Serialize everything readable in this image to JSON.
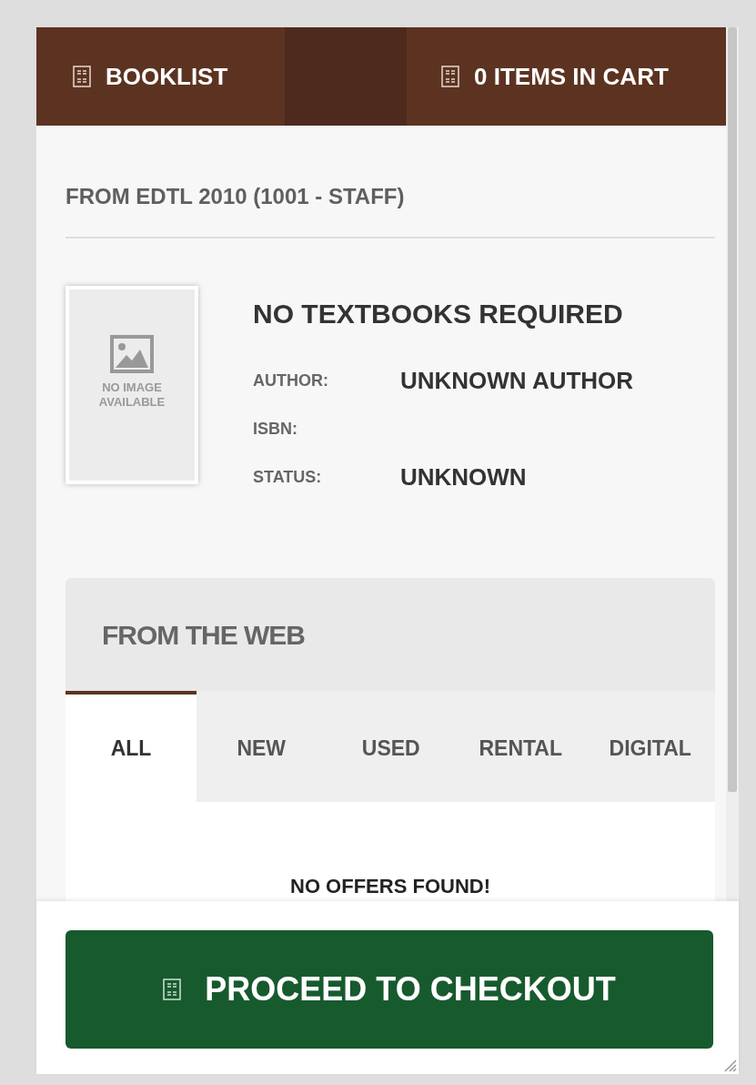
{
  "nav": {
    "booklist": "BOOKLIST",
    "cart": "0 ITEMS IN CART"
  },
  "course": "FROM EDTL 2010 (1001 - STAFF)",
  "book": {
    "cover_text": "NO IMAGE AVAILABLE",
    "title": "NO TEXTBOOKS REQUIRED",
    "fields": [
      {
        "label": "AUTHOR:",
        "value": "UNKNOWN AUTHOR"
      },
      {
        "label": "ISBN:"
      },
      {
        "label": "STATUS:",
        "value": "UNKNOWN"
      }
    ]
  },
  "offers": {
    "title": "FROM THE WEB",
    "tabs": [
      {
        "label": "ALL",
        "selected": true
      },
      {
        "label": "NEW",
        "selected": false
      },
      {
        "label": "USED",
        "selected": false
      },
      {
        "label": "RENTAL",
        "selected": false
      },
      {
        "label": "DIGITAL",
        "selected": false
      }
    ],
    "message": "NO OFFERS FOUND!"
  },
  "checkout_button": "PROCEED TO CHECKOUT"
}
